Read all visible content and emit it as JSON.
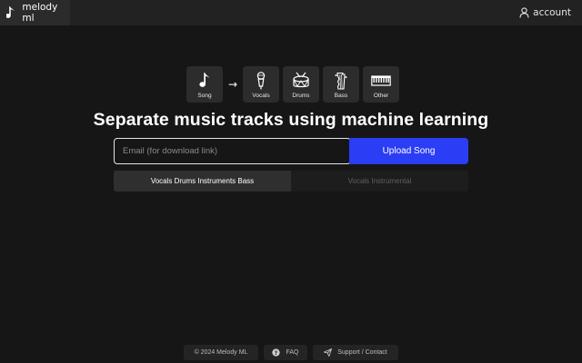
{
  "header": {
    "brand": "melody ml",
    "brand_icon": "music-note-icon",
    "account_label": "account",
    "account_icon": "user-icon"
  },
  "pipeline": {
    "source": {
      "label": "Song",
      "icon": "music-note-icon"
    },
    "arrow": "→",
    "targets": [
      {
        "label": "Vocals",
        "icon": "microphone-icon"
      },
      {
        "label": "Drums",
        "icon": "drum-icon"
      },
      {
        "label": "Bass",
        "icon": "bass-guitar-icon"
      },
      {
        "label": "Other",
        "icon": "piano-keys-icon"
      }
    ]
  },
  "main": {
    "headline": "Separate music tracks using machine learning",
    "email_placeholder": "Email (for download link)",
    "email_value": "",
    "upload_label": "Upload Song",
    "modes": [
      {
        "label": "Vocals Drums Instruments Bass",
        "active": true
      },
      {
        "label": "Vocals Instrumental",
        "active": false
      }
    ]
  },
  "footer": {
    "copyright": "© 2024 Melody ML",
    "faq": "FAQ",
    "faq_icon": "question-circle-icon",
    "support": "Support / Contact",
    "support_icon": "paper-plane-icon"
  },
  "colors": {
    "background": "#161616",
    "topbar": "#222222",
    "accent": "#2b3df5",
    "tile": "#2c2c2c"
  }
}
